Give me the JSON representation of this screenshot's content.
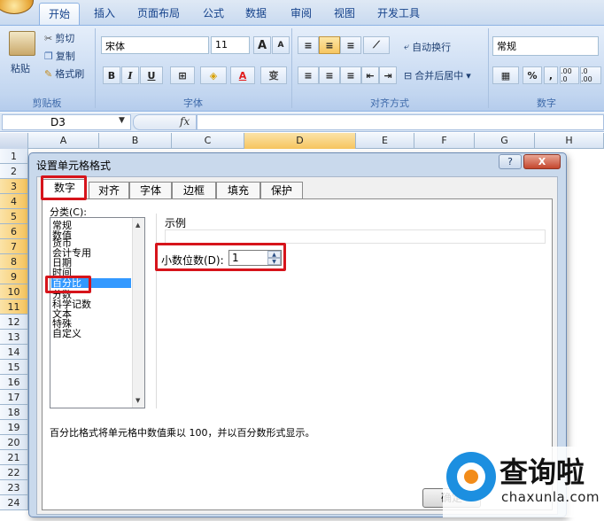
{
  "ribbon": {
    "tabs": [
      "开始",
      "插入",
      "页面布局",
      "公式",
      "数据",
      "审阅",
      "视图",
      "开发工具"
    ],
    "clipboard": {
      "paste": "粘贴",
      "cut": "剪切",
      "copy": "复制",
      "format_painter": "格式刷",
      "label": "剪贴板"
    },
    "font": {
      "name": "宋体",
      "size": "11",
      "bold": "B",
      "italic": "I",
      "underline": "U",
      "color_letter": "A",
      "phonetic": "变",
      "label": "字体",
      "grow": "A",
      "shrink": "A"
    },
    "alignment": {
      "wrap": "自动换行",
      "merge": "合并后居中",
      "label": "对齐方式"
    },
    "number": {
      "format": "常规",
      "percent": "%",
      "comma": ",",
      "inc": ".00 .0",
      "dec": ".0 .00",
      "label": "数字"
    }
  },
  "formula_bar": {
    "name_box": "D3",
    "fx": "fx"
  },
  "sheet": {
    "columns": [
      "A",
      "B",
      "C",
      "D",
      "E",
      "F",
      "G",
      "H"
    ],
    "selected_column": "D",
    "rows": [
      "1",
      "2",
      "3",
      "4",
      "5",
      "6",
      "7",
      "8",
      "9",
      "10",
      "11",
      "12",
      "13",
      "14",
      "15",
      "16",
      "17",
      "18",
      "19",
      "20",
      "21",
      "22",
      "23",
      "24"
    ],
    "selected_rows": [
      "3",
      "4",
      "5",
      "6",
      "7",
      "8",
      "9",
      "10",
      "11"
    ]
  },
  "dialog": {
    "title": "设置单元格格式",
    "help": "?",
    "close": "X",
    "tabs": [
      "数字",
      "对齐",
      "字体",
      "边框",
      "填充",
      "保护"
    ],
    "category_label": "分类(C):",
    "categories": [
      "常规",
      "数值",
      "货币",
      "会计专用",
      "日期",
      "时间",
      "百分比",
      "分数",
      "科学记数",
      "文本",
      "特殊",
      "自定义"
    ],
    "selected_category": "百分比",
    "sample_label": "示例",
    "decimal_label": "小数位数(D):",
    "decimal_value": "1",
    "description": "百分比格式将单元格中数值乘以 100，并以百分数形式显示。",
    "ok_label": "确定"
  },
  "watermark": {
    "cn": "查询啦",
    "url": "chaxunla.com"
  }
}
